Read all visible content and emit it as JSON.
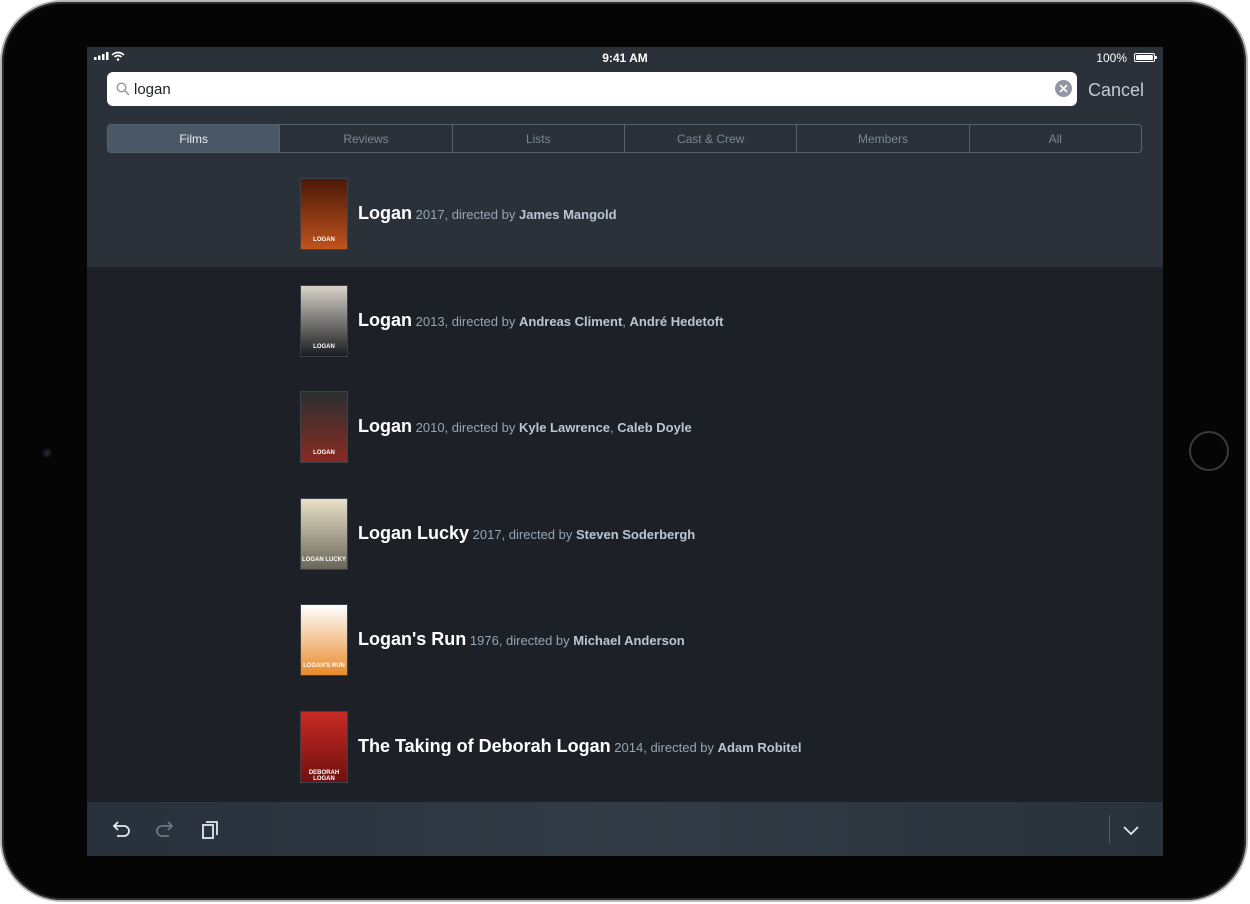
{
  "status_bar": {
    "time": "9:41 AM",
    "battery": "100%"
  },
  "search": {
    "query": "logan",
    "cancel_label": "Cancel"
  },
  "tabs": [
    {
      "label": "Films",
      "active": true
    },
    {
      "label": "Reviews",
      "active": false
    },
    {
      "label": "Lists",
      "active": false
    },
    {
      "label": "Cast & Crew",
      "active": false
    },
    {
      "label": "Members",
      "active": false
    },
    {
      "label": "All",
      "active": false
    }
  ],
  "results": [
    {
      "title": "Logan",
      "meta": "2017, directed by",
      "directors": [
        "James Mangold"
      ],
      "poster_text": "LOGAN",
      "poster_colors": [
        "#4a1808",
        "#c0531c"
      ]
    },
    {
      "title": "Logan",
      "meta": "2013, directed by",
      "directors": [
        "Andreas Climent",
        "André Hedetoft"
      ],
      "poster_text": "LOGAN",
      "poster_colors": [
        "#d8d2c8",
        "#1a1c22"
      ]
    },
    {
      "title": "Logan",
      "meta": "2010, directed by",
      "directors": [
        "Kyle Lawrence",
        "Caleb Doyle"
      ],
      "poster_text": "LOGAN",
      "poster_colors": [
        "#2a3030",
        "#8a2a22"
      ]
    },
    {
      "title": "Logan Lucky",
      "meta": "2017, directed by",
      "directors": [
        "Steven Soderbergh"
      ],
      "poster_text": "LOGAN LUCKY",
      "poster_colors": [
        "#e8e0c8",
        "#6a6658"
      ]
    },
    {
      "title": "Logan's Run",
      "meta": "1976, directed by",
      "directors": [
        "Michael Anderson"
      ],
      "poster_text": "LOGAN'S RUN",
      "poster_colors": [
        "#ffffff",
        "#e88a2a"
      ]
    },
    {
      "title": "The Taking of Deborah Logan",
      "meta": "2014, directed by",
      "directors": [
        "Adam Robitel"
      ],
      "poster_text": "DEBORAH LOGAN",
      "poster_colors": [
        "#c82a22",
        "#701010"
      ]
    }
  ],
  "toolbar": {
    "icons": [
      "undo-icon",
      "redo-icon",
      "paste-icon",
      "chevron-down-icon"
    ]
  }
}
